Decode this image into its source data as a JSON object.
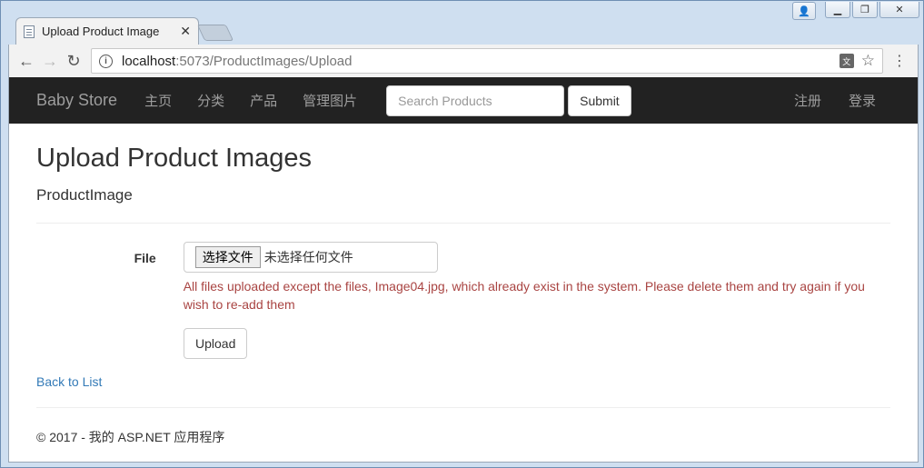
{
  "browser": {
    "tab_title": "Upload Product Image",
    "url_host": "localhost",
    "url_path": ":5073/ProductImages/Upload",
    "tab_close": "✕"
  },
  "navbar": {
    "brand": "Baby Store",
    "links": [
      "主页",
      "分类",
      "产品",
      "管理图片"
    ],
    "search_placeholder": "Search Products",
    "submit_label": "Submit",
    "right_links": [
      "注册",
      "登录"
    ]
  },
  "main": {
    "title": "Upload Product Images",
    "subtitle": "ProductImage",
    "file_label": "File",
    "file_button": "选择文件",
    "file_status": "未选择任何文件",
    "error_message": "All files uploaded except the files, Image04.jpg, which already exist in the system. Please delete them and try again if you wish to re-add them",
    "upload_label": "Upload",
    "back_link": "Back to List"
  },
  "footer": {
    "text": "© 2017 - 我的 ASP.NET 应用程序"
  },
  "icons": {
    "back": "←",
    "forward": "→",
    "reload": "↻",
    "info": "i",
    "star": "☆",
    "menu": "⋮",
    "translate": "文"
  },
  "colors": {
    "navbar_bg": "#222222",
    "error": "#a94442",
    "link": "#337ab7"
  }
}
